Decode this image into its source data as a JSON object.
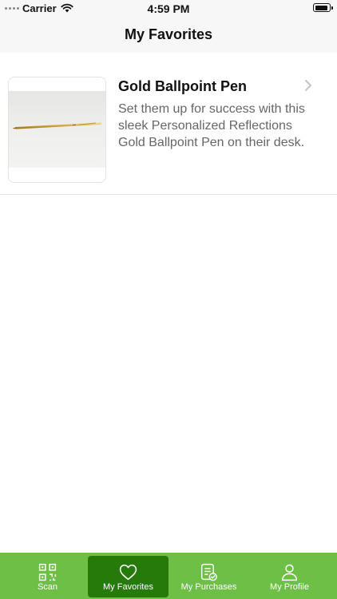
{
  "status_bar": {
    "carrier": "Carrier",
    "time": "4:59 PM",
    "icons": [
      "signal-dots-icon",
      "wifi-icon",
      "battery-icon"
    ]
  },
  "header": {
    "title": "My Favorites"
  },
  "favorites": [
    {
      "title": "Gold Ballpoint Pen",
      "description": "Set them up for success with this sleek Personalized Reflections Gold Ballpoint Pen on their desk.",
      "image": "gold-ballpoint-pen-image",
      "chevron_icon": "chevron-right-icon"
    }
  ],
  "tab_bar": {
    "background_color": "#6dbf45",
    "active_color": "#267a0a",
    "tabs": [
      {
        "label": "Scan",
        "icon": "qr-code-icon",
        "active": false
      },
      {
        "label": "My Favorites",
        "icon": "heart-icon",
        "active": true
      },
      {
        "label": "My Purchases",
        "icon": "receipt-check-icon",
        "active": false
      },
      {
        "label": "My Profile",
        "icon": "person-icon",
        "active": false
      }
    ]
  }
}
